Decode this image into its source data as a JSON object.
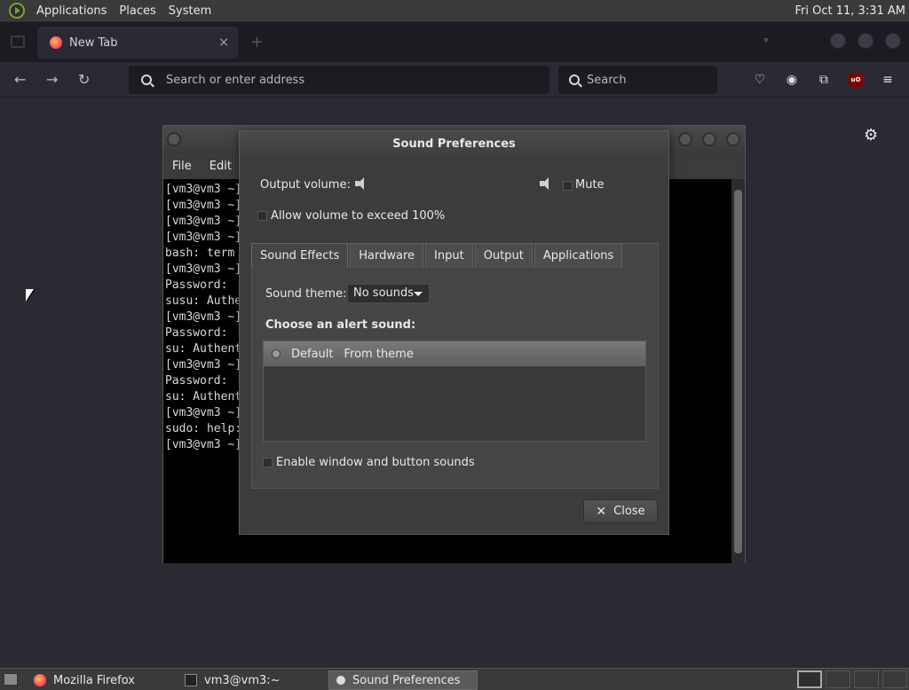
{
  "topbar": {
    "menus": [
      "Applications",
      "Places",
      "System"
    ],
    "clock": "Fri Oct 11,  3:31 AM"
  },
  "firefox": {
    "tab_title": "New Tab",
    "tab_close": "×",
    "new_tab": "+",
    "url_placeholder": "Search or enter address",
    "search_placeholder": "Search",
    "ublock_label": "uO"
  },
  "terminal": {
    "menus": [
      "File",
      "Edit"
    ],
    "lines": [
      "[vm3@vm3 ~]",
      "[vm3@vm3 ~]",
      "[vm3@vm3 ~]",
      "[vm3@vm3 ~]",
      "bash: term",
      "[vm3@vm3 ~]",
      "Password:",
      "susu: Authe",
      "[vm3@vm3 ~]",
      "Password:",
      "su: Authent",
      "[vm3@vm3 ~]",
      "Password:",
      "su: Authent",
      "[vm3@vm3 ~]",
      "sudo: help:",
      "[vm3@vm3 ~]"
    ]
  },
  "dialog": {
    "title": "Sound Preferences",
    "output_volume_label": "Output volume:",
    "mute_label": "Mute",
    "exceed_label": "Allow volume to exceed 100%",
    "tabs": [
      "Sound Effects",
      "Hardware",
      "Input",
      "Output",
      "Applications"
    ],
    "active_tab": "Sound Effects",
    "sound_theme_label": "Sound theme:",
    "sound_theme_value": "No sounds",
    "alert_heading": "Choose an alert sound:",
    "alerts": [
      {
        "name": "Default",
        "source": "From theme"
      }
    ],
    "enable_sounds_label": "Enable window and button sounds",
    "close_label": "Close"
  },
  "taskbar": {
    "tasks": [
      {
        "label": "Mozilla Firefox",
        "active": false
      },
      {
        "label": "vm3@vm3:~",
        "active": false
      },
      {
        "label": "Sound Preferences",
        "active": true
      }
    ]
  }
}
